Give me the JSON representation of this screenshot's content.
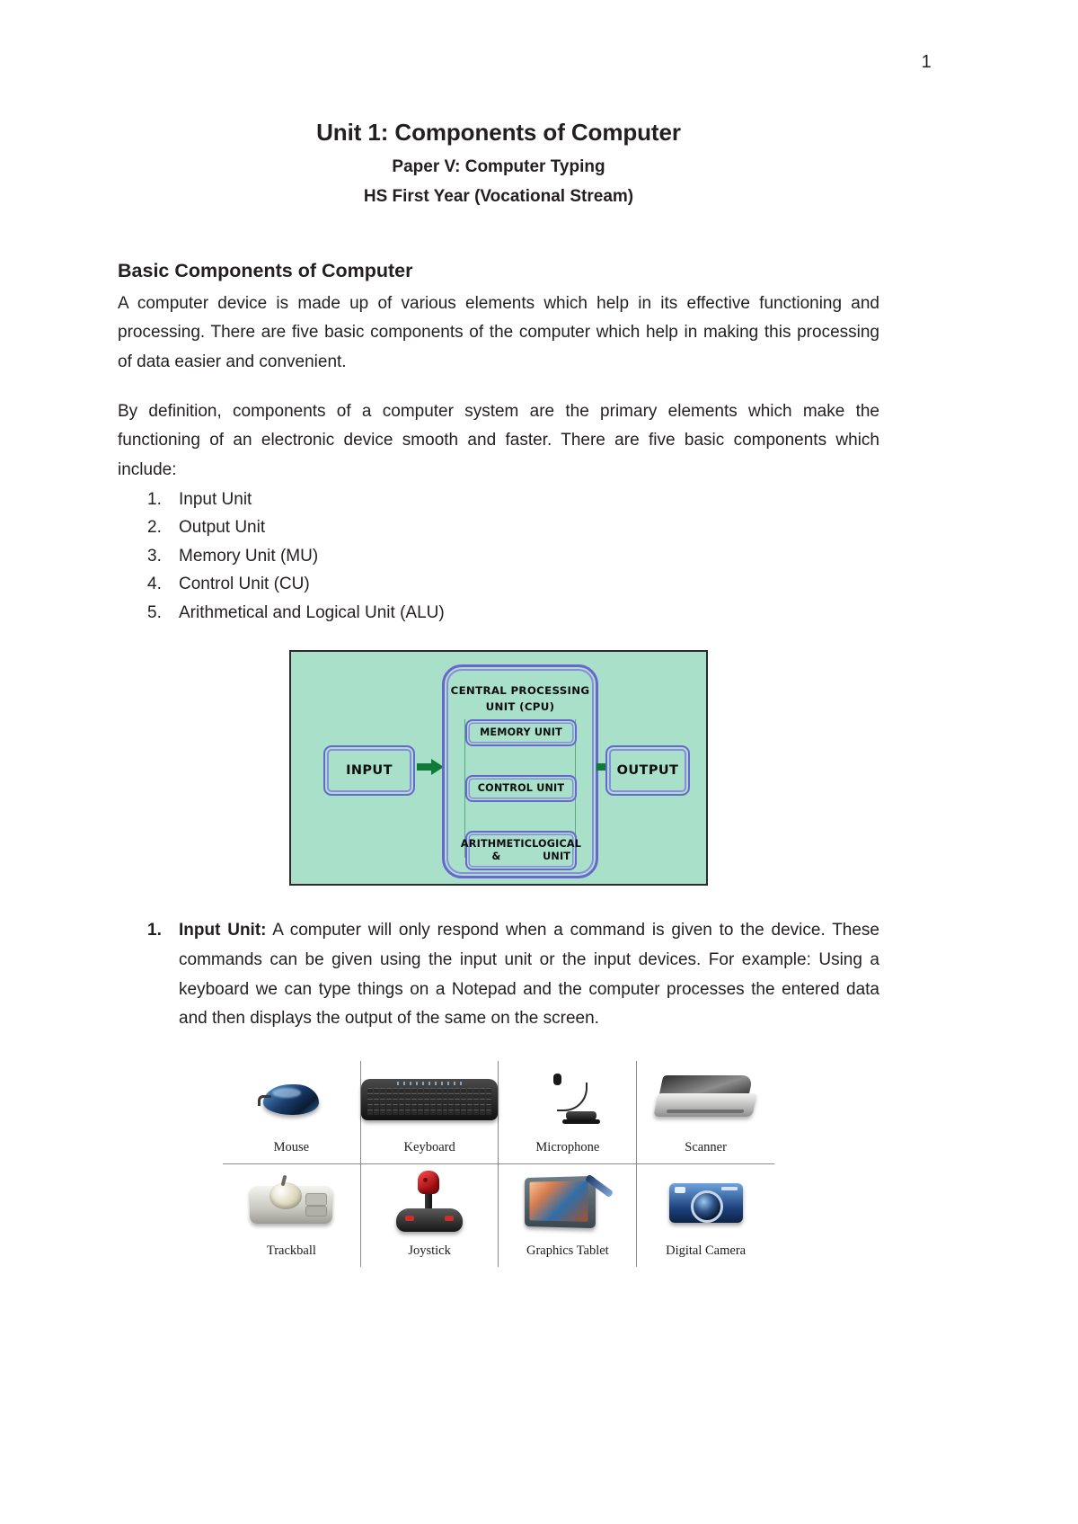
{
  "page": {
    "number": "1"
  },
  "header": {
    "title": "Unit 1: Components of Computer",
    "subtitle_1": "Paper V: Computer Typing",
    "subtitle_2": "HS First Year (Vocational Stream)"
  },
  "section": {
    "heading": "Basic Components of Computer",
    "paragraph_1": "A computer device is made up of various elements which help in its effective functioning and processing. There are five basic components of the computer which help in making this processing of data easier and convenient.",
    "paragraph_2": "By definition, components of a computer system are the primary elements which make the functioning of an electronic device smooth and faster. There are five basic components which include:"
  },
  "components_list": [
    {
      "num": "1.",
      "label": "Input Unit"
    },
    {
      "num": "2.",
      "label": "Output Unit"
    },
    {
      "num": "3.",
      "label": "Memory Unit (MU)"
    },
    {
      "num": "4.",
      "label": "Control Unit (CU)"
    },
    {
      "num": "5.",
      "label": "Arithmetical and Logical Unit (ALU)"
    }
  ],
  "diagram": {
    "input_label": "INPUT",
    "output_label": "OUTPUT",
    "cpu_label": "CENTRAL PROCESSING UNIT (CPU)",
    "cpu_label_line1": "CENTRAL PROCESSING",
    "cpu_label_line2": "UNIT (CPU)",
    "memory_label": "MEMORY UNIT",
    "control_label": "CONTROL UNIT",
    "alu_label_line1": "ARITHMETIC &",
    "alu_label_line2": "LOGICAL UNIT",
    "colors": {
      "background": "#a8e0ca",
      "box_border": "#6b66cf",
      "arrow": "#117a38",
      "outer_border": "#2b2b2b",
      "text": "#0d0d0d"
    }
  },
  "explanation": [
    {
      "num": "1.",
      "lead": "Input Unit:",
      "text": " A computer will only respond when a command is given to the device. These commands can be given using the input unit or the input devices.  For example: Using a keyboard we can type things on a Notepad and the computer processes the entered data and then displays the output of the same on the screen."
    }
  ],
  "device_table": {
    "rows": [
      [
        {
          "label": "Mouse",
          "icon": "mouse-icon"
        },
        {
          "label": "Keyboard",
          "icon": "keyboard-icon"
        },
        {
          "label": "Microphone",
          "icon": "microphone-icon"
        },
        {
          "label": "Scanner",
          "icon": "scanner-icon"
        }
      ],
      [
        {
          "label": "Trackball",
          "icon": "trackball-icon"
        },
        {
          "label": "Joystick",
          "icon": "joystick-icon"
        },
        {
          "label": "Graphics Tablet",
          "icon": "graphics-tablet-icon"
        },
        {
          "label": "Digital Camera",
          "icon": "digital-camera-icon"
        }
      ]
    ]
  }
}
